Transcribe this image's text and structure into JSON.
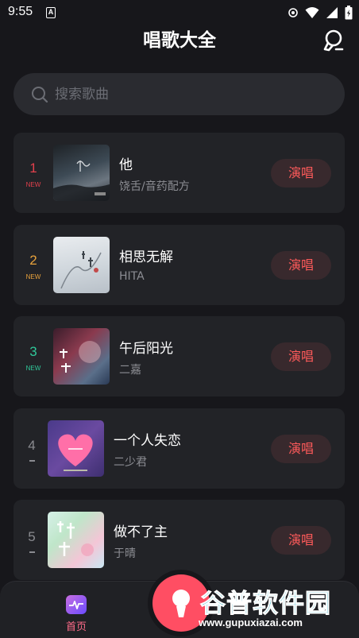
{
  "status_bar": {
    "time": "9:55",
    "badge": "A"
  },
  "header": {
    "title": "唱歌大全"
  },
  "search": {
    "placeholder": "搜索歌曲"
  },
  "songs": [
    {
      "rank": "1",
      "tag": "NEW",
      "rank_color": "#e2404c",
      "title": "他",
      "artist": "饶舌/音药配方",
      "button": "演唱"
    },
    {
      "rank": "2",
      "tag": "NEW",
      "rank_color": "#e8a23c",
      "title": "相思无解",
      "artist": "HITA",
      "button": "演唱"
    },
    {
      "rank": "3",
      "tag": "NEW",
      "rank_color": "#2fc89a",
      "title": "午后阳光",
      "artist": "二嘉",
      "button": "演唱"
    },
    {
      "rank": "4",
      "tag": "",
      "rank_color": "#8a8b90",
      "title": "一个人失恋",
      "artist": "二少君",
      "button": "演唱"
    },
    {
      "rank": "5",
      "tag": "",
      "rank_color": "#8a8b90",
      "title": "做不了主",
      "artist": "于晴",
      "button": "演唱"
    }
  ],
  "nav": {
    "home_label": "首页"
  },
  "watermark": {
    "title": "谷普软件园",
    "url": "www.gupuxiazai.com"
  },
  "colors": {
    "accent": "#ff5a5a",
    "background": "#17171b",
    "card": "#222327"
  }
}
